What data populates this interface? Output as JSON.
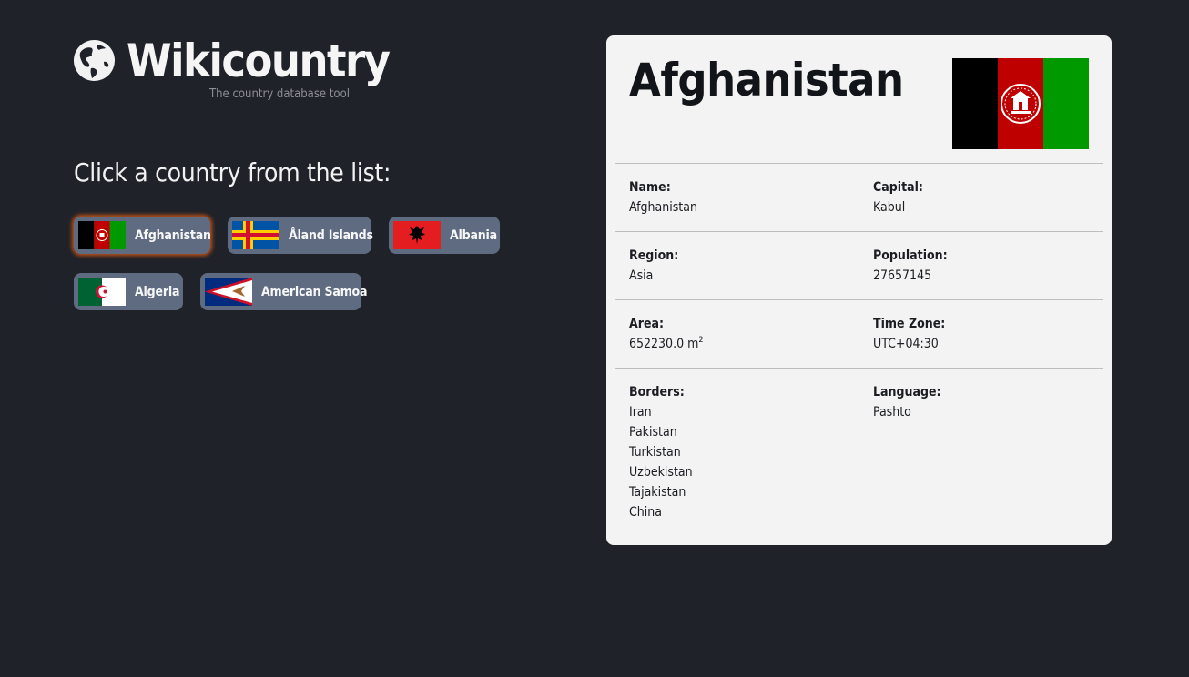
{
  "app": {
    "title": "Wikicountry",
    "tagline": "The country database tool",
    "logo_icon": "globe-icon"
  },
  "list": {
    "prompt": "Click a country from the list:",
    "countries": [
      {
        "name": "Afghanistan",
        "flag": "afghanistan-flag-icon",
        "selected": true
      },
      {
        "name": "Åland Islands",
        "flag": "aland-islands-flag-icon",
        "selected": false
      },
      {
        "name": "Albania",
        "flag": "albania-flag-icon",
        "selected": false
      },
      {
        "name": "Algeria",
        "flag": "algeria-flag-icon",
        "selected": false
      },
      {
        "name": "American Samoa",
        "flag": "american-samoa-flag-icon",
        "selected": false
      }
    ]
  },
  "details": {
    "name": "Afghanistan",
    "flag": "afghanistan-flag-icon",
    "fields": {
      "name": {
        "label": "Name:",
        "value": "Afghanistan"
      },
      "capital": {
        "label": "Capital:",
        "value": "Kabul"
      },
      "region": {
        "label": "Region:",
        "value": "Asia"
      },
      "population": {
        "label": "Population:",
        "value": "27657145"
      },
      "area": {
        "label": "Area:",
        "value": "652230.0 m",
        "unit_sup": "2"
      },
      "timezone": {
        "label": "Time Zone:",
        "value": "UTC+04:30"
      },
      "borders": {
        "label": "Borders:",
        "values": [
          "Iran",
          "Pakistan",
          "Turkistan",
          "Uzbekistan",
          "Tajakistan",
          "China"
        ]
      },
      "language": {
        "label": "Language:",
        "value": "Pashto"
      }
    }
  },
  "colors": {
    "background": "#1f2229",
    "button": "#5f6b80",
    "selected_glow": "#c0521a",
    "card": "#f3f3f3"
  }
}
